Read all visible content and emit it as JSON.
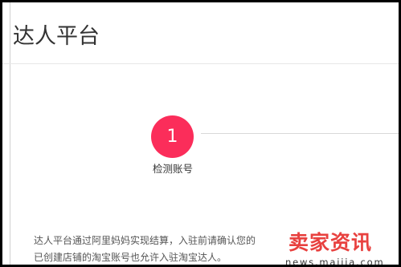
{
  "page": {
    "title": "达人平台"
  },
  "steps": [
    {
      "number": "1",
      "label": "检测账号",
      "active": true
    }
  ],
  "intro": {
    "line1": "达人平台通过阿里妈妈实现结算，入驻前请确认您的",
    "line2": "已创建店铺的淘宝账号也允许入驻淘宝达人。"
  },
  "watermark": {
    "logo_text": "卖家资讯",
    "url": "news.maijia.com"
  },
  "colors": {
    "accent": "#fb2d5a",
    "title_text": "#333333",
    "body_text": "#555555",
    "watermark": "#e8413f"
  }
}
